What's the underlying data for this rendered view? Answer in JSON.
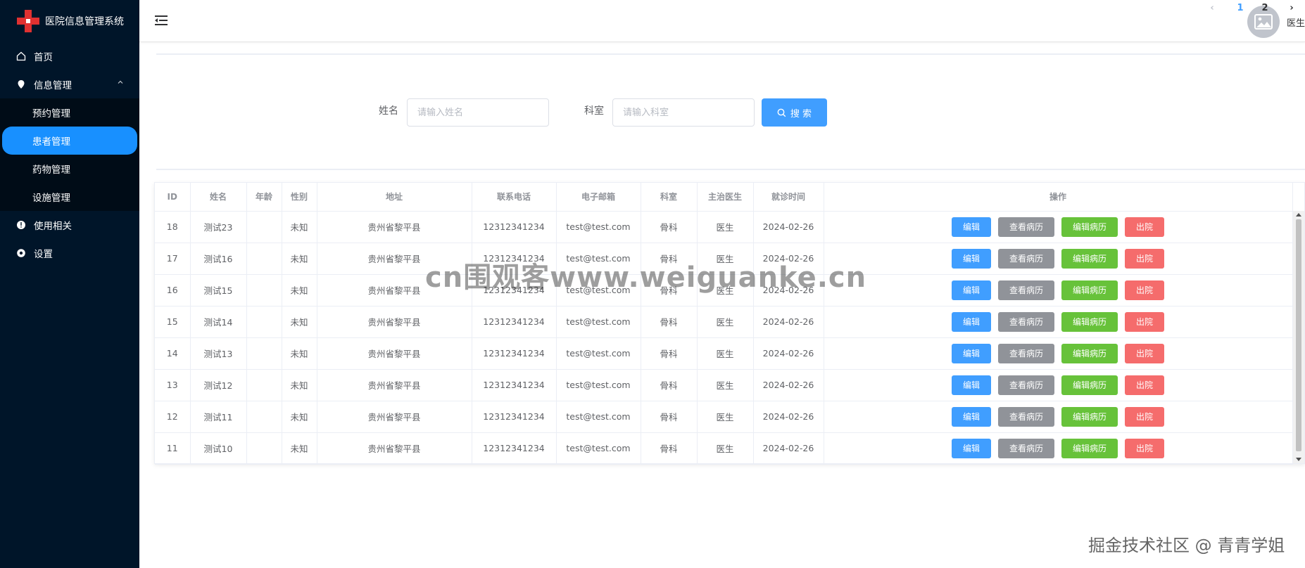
{
  "app": {
    "title": "医院信息管理系统"
  },
  "sidebar": {
    "home": "首页",
    "info_mgmt": "信息管理",
    "submenu": [
      "预约管理",
      "患者管理",
      "药物管理",
      "设施管理"
    ],
    "usage": "使用相关",
    "settings": "设置"
  },
  "header": {
    "user_name": "医生"
  },
  "search": {
    "name_label": "姓名",
    "name_placeholder": "请输入姓名",
    "dept_label": "科室",
    "dept_placeholder": "请输入科室",
    "button": "搜 索"
  },
  "table": {
    "columns": [
      "ID",
      "姓名",
      "年龄",
      "性别",
      "地址",
      "联系电话",
      "电子邮箱",
      "科室",
      "主治医生",
      "就诊时间",
      "操作"
    ],
    "rows": [
      [
        "18",
        "测试23",
        "",
        "未知",
        "贵州省黎平县",
        "12312341234",
        "test@test.com",
        "骨科",
        "医生",
        "2024-02-26"
      ],
      [
        "17",
        "测试16",
        "",
        "未知",
        "贵州省黎平县",
        "12312341234",
        "test@test.com",
        "骨科",
        "医生",
        "2024-02-26"
      ],
      [
        "16",
        "测试15",
        "",
        "未知",
        "贵州省黎平县",
        "12312341234",
        "test@test.com",
        "骨科",
        "医生",
        "2024-02-26"
      ],
      [
        "15",
        "测试14",
        "",
        "未知",
        "贵州省黎平县",
        "12312341234",
        "test@test.com",
        "骨科",
        "医生",
        "2024-02-26"
      ],
      [
        "14",
        "测试13",
        "",
        "未知",
        "贵州省黎平县",
        "12312341234",
        "test@test.com",
        "骨科",
        "医生",
        "2024-02-26"
      ],
      [
        "13",
        "测试12",
        "",
        "未知",
        "贵州省黎平县",
        "12312341234",
        "test@test.com",
        "骨科",
        "医生",
        "2024-02-26"
      ],
      [
        "12",
        "测试11",
        "",
        "未知",
        "贵州省黎平县",
        "12312341234",
        "test@test.com",
        "骨科",
        "医生",
        "2024-02-26"
      ],
      [
        "11",
        "测试10",
        "",
        "未知",
        "贵州省黎平县",
        "12312341234",
        "test@test.com",
        "骨科",
        "医生",
        "2024-02-26"
      ]
    ],
    "actions": {
      "edit": "编辑",
      "view_record": "查看病历",
      "edit_record": "编辑病历",
      "discharge": "出院"
    }
  },
  "pagination": {
    "pages": [
      "1",
      "2"
    ],
    "current": "1",
    "prev": "‹",
    "next": "›"
  },
  "watermarks": {
    "center": "cn围观客www.weiguanke.cn",
    "bottom": "掘金技术社区 @ 青青学姐"
  },
  "colors": {
    "sidebar_bg": "#001529",
    "accent": "#409eff",
    "active_menu": "#1890ff",
    "success": "#67c23a",
    "info": "#909399",
    "danger": "#f56c6c"
  }
}
